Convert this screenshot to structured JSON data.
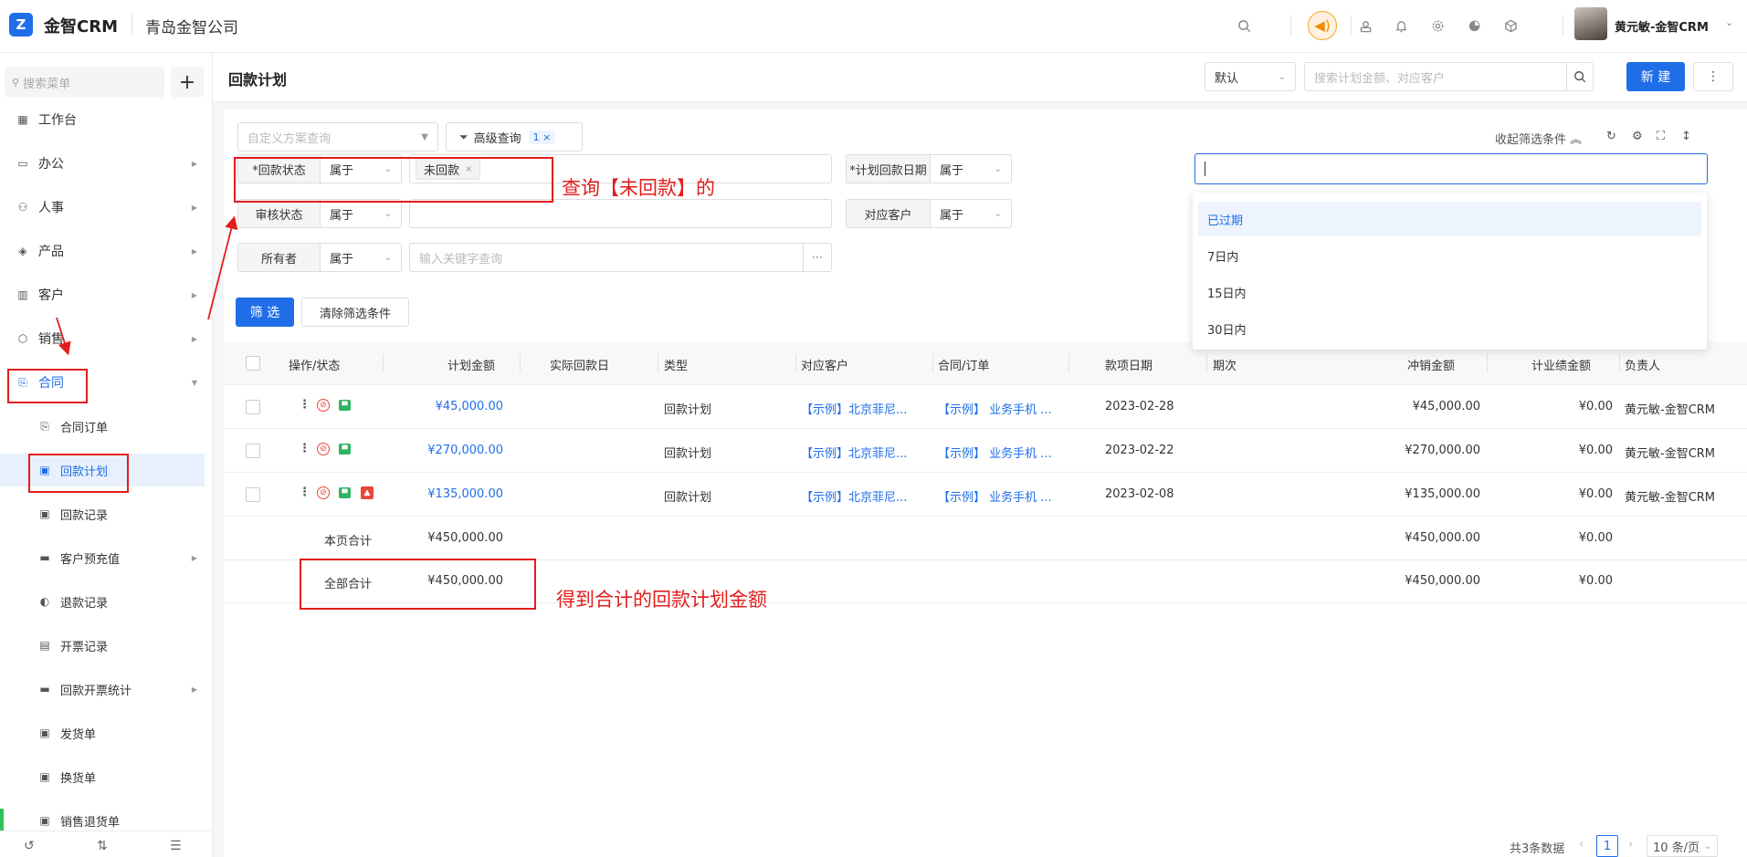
{
  "topbar": {
    "logo_letter": "Z",
    "app_name": "金智CRM",
    "company": "青岛金智公司",
    "user_name": "黄元敏-金智CRM",
    "icons": [
      "search-icon",
      "speaker-icon",
      "contacts-icon",
      "bell-icon",
      "gear-icon",
      "pie-chart-icon",
      "cube-icon"
    ]
  },
  "sidebar": {
    "search_placeholder": "搜索菜单",
    "add_label": "+",
    "items": [
      {
        "label": "工作台",
        "icon": "dashboard-icon"
      },
      {
        "label": "办公",
        "icon": "office-icon"
      },
      {
        "label": "人事",
        "icon": "people-icon"
      },
      {
        "label": "产品",
        "icon": "product-icon"
      },
      {
        "label": "客户",
        "icon": "customer-icon"
      },
      {
        "label": "销售",
        "icon": "sales-icon"
      },
      {
        "label": "合同",
        "icon": "contract-icon"
      }
    ],
    "sub_items": [
      {
        "label": "合同订单"
      },
      {
        "label": "回款计划"
      },
      {
        "label": "回款记录"
      },
      {
        "label": "客户预充值"
      },
      {
        "label": "退款记录"
      },
      {
        "label": "开票记录"
      },
      {
        "label": "回款开票统计"
      },
      {
        "label": "发货单"
      },
      {
        "label": "换货单"
      },
      {
        "label": "销售退货单"
      }
    ]
  },
  "header": {
    "page_title": "回款计划",
    "view_select": "默认",
    "search_placeholder": "搜索计划金额、对应客户",
    "new_button": "新 建",
    "more_button": "⋮"
  },
  "filters": {
    "custom_scheme_placeholder": "自定义方案查询",
    "advanced_query": "高级查询",
    "advanced_count": "1 ×",
    "collapse_label": "收起筛选条件",
    "rows": [
      {
        "label": "*回款状态",
        "op": "属于",
        "tag": "未回款"
      },
      {
        "label": "审核状态",
        "op": "属于"
      },
      {
        "label": "所有者",
        "op": "属于",
        "placeholder": "输入关键字查询"
      },
      {
        "label": "*计划回款日期",
        "op": "属于"
      },
      {
        "label": "对应客户",
        "op": "属于"
      }
    ],
    "filter_button": "筛 选",
    "clear_button": "清除筛选条件",
    "dropdown_options": [
      "已过期",
      "7日内",
      "15日内",
      "30日内"
    ]
  },
  "table": {
    "columns": [
      "操作/状态",
      "计划金额",
      "实际回款日",
      "类型",
      "对应客户",
      "合同/订单",
      "款项日期",
      "期次",
      "冲销金额",
      "计业绩金额",
      "负责人"
    ],
    "rows": [
      {
        "amount": "¥45,000.00",
        "actual_date": "",
        "type": "回款计划",
        "customer": "【示例】北京菲尼...",
        "contract": "【示例】 业务手机 ...",
        "date": "2023-02-28",
        "period": "",
        "writeoff": "¥45,000.00",
        "perf": "¥0.00",
        "owner": "黄元敏-金智CRM"
      },
      {
        "amount": "¥270,000.00",
        "actual_date": "",
        "type": "回款计划",
        "customer": "【示例】北京菲尼...",
        "contract": "【示例】 业务手机 ...",
        "date": "2023-02-22",
        "period": "",
        "writeoff": "¥270,000.00",
        "perf": "¥0.00",
        "owner": "黄元敏-金智CRM"
      },
      {
        "amount": "¥135,000.00",
        "actual_date": "",
        "type": "回款计划",
        "customer": "【示例】北京菲尼...",
        "contract": "【示例】 业务手机 ...",
        "date": "2023-02-08",
        "period": "",
        "writeoff": "¥135,000.00",
        "perf": "¥0.00",
        "owner": "黄元敏-金智CRM"
      }
    ],
    "page_total": {
      "label": "本页合计",
      "amount": "¥450,000.00",
      "writeoff": "¥450,000.00",
      "perf": "¥0.00"
    },
    "all_total": {
      "label": "全部合计",
      "amount": "¥450,000.00",
      "writeoff": "¥450,000.00",
      "perf": "¥0.00"
    }
  },
  "pagination": {
    "total_text": "共3条数据",
    "current_page": "1",
    "page_size": "10 条/页"
  },
  "annotations": {
    "query_note": "查询【未回款】的",
    "total_note": "得到合计的回款计划金额"
  },
  "colors": {
    "primary": "#1f6ee8",
    "annotation": "#e21d1d",
    "speaker": "#f08c00"
  }
}
